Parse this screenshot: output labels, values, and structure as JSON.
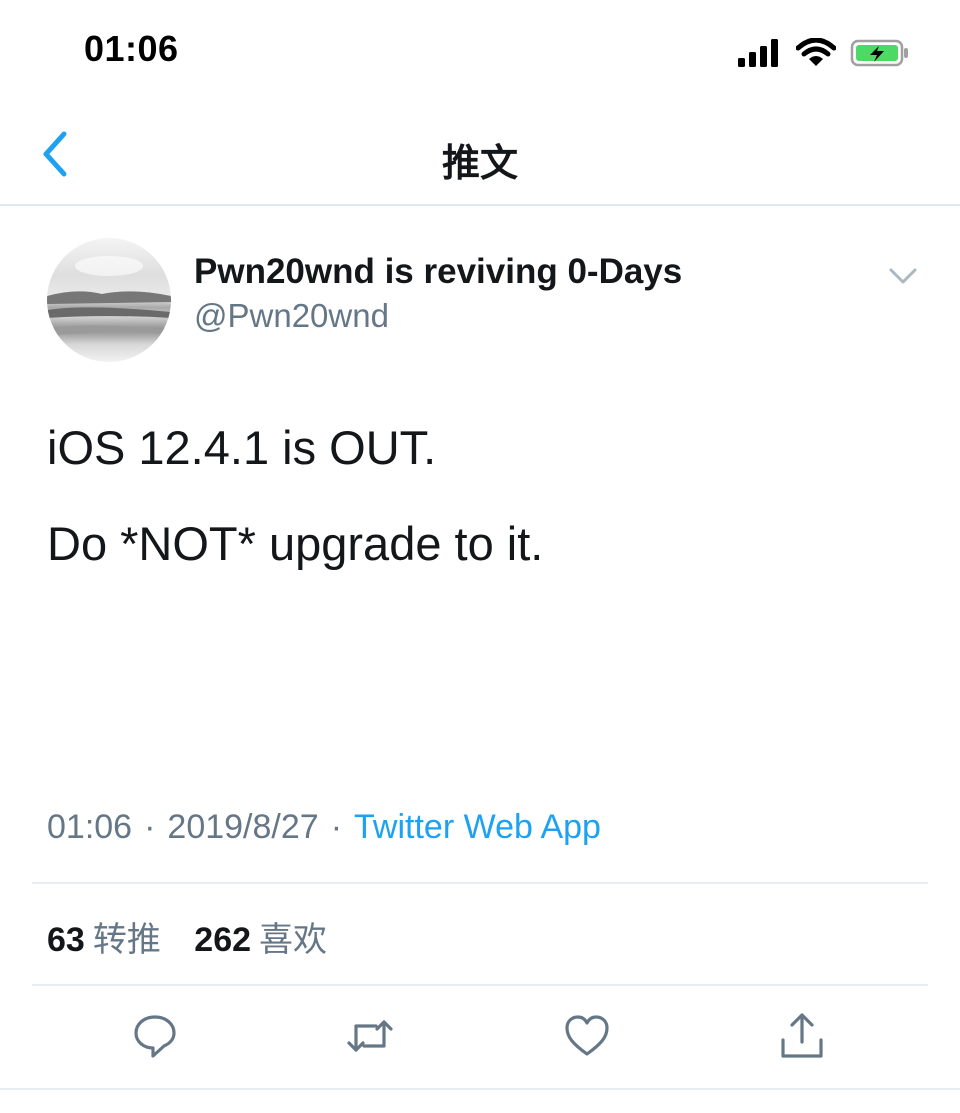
{
  "status_bar": {
    "time": "01:06"
  },
  "nav": {
    "title": "推文"
  },
  "tweet": {
    "display_name": "Pwn20wnd is reviving 0-Days",
    "handle": "@Pwn20wnd",
    "text_lines": [
      "iOS 12.4.1 is OUT.",
      "Do *NOT* upgrade to it."
    ],
    "time": "01:06",
    "date": "2019/8/27",
    "separator": "·",
    "source": "Twitter Web App"
  },
  "stats": {
    "retweets_count": "63",
    "retweets_label": "转推",
    "likes_count": "262",
    "likes_label": "喜欢"
  },
  "icons": {
    "back": "chevron-left-icon",
    "caret": "chevron-down-icon",
    "reply": "reply-icon",
    "retweet": "retweet-icon",
    "like": "heart-icon",
    "share": "share-icon"
  },
  "colors": {
    "accent": "#1da1f2",
    "secondary_text": "#657786",
    "primary_text": "#14171a",
    "battery_green": "#4cd964"
  }
}
